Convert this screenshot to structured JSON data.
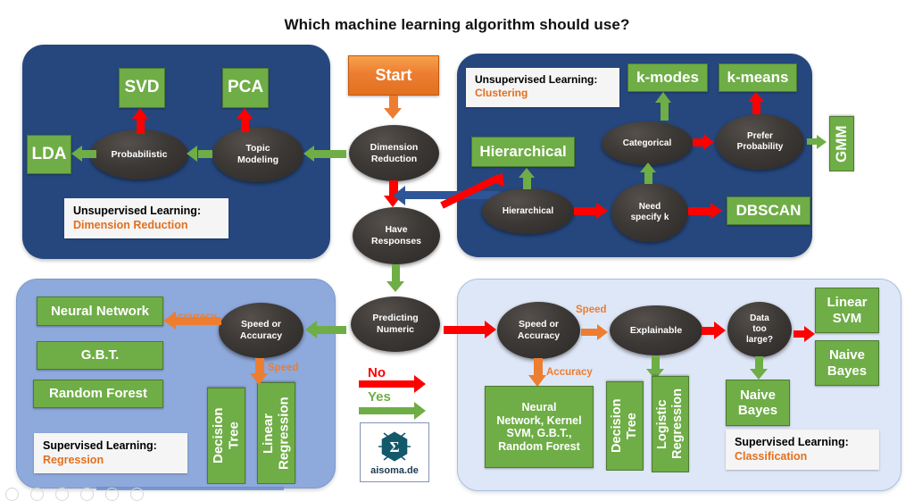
{
  "title": "Which machine learning algorithm should use?",
  "panels": {
    "dimension_reduction": {
      "caption_line1": "Unsupervised Learning:",
      "caption_line2": "Dimension Reduction",
      "color": "#26477E"
    },
    "clustering": {
      "caption_line1": "Unsupervised Learning:",
      "caption_line2": "Clustering",
      "color": "#26477E"
    },
    "regression": {
      "caption_line1": "Supervised Learning:",
      "caption_line2": "Regression",
      "color": "#8EA9DB"
    },
    "classification": {
      "caption_line1": "Supervised Learning:",
      "caption_line2": "Classification",
      "color": "#DEE7F7"
    }
  },
  "start": {
    "label": "Start"
  },
  "spine": {
    "dimension_reduction": "Dimension\nReduction",
    "have_responses": "Have\nResponses",
    "predicting_numeric": "Predicting\nNumeric"
  },
  "nodes": {
    "probabilistic": "Probabilistic",
    "topic_modeling": "Topic\nModeling",
    "hierarchical": "Hierarchical",
    "need_specify_k": "Need\nspecify k",
    "categorical": "Categorical",
    "prefer_probability": "Prefer\nProbability",
    "speed_or_accuracy_reg": "Speed or\nAccuracy",
    "speed_or_accuracy_cls": "Speed or\nAccuracy",
    "explainable": "Explainable",
    "data_too_large": "Data\ntoo\nlarge?"
  },
  "outcomes": {
    "svd": "SVD",
    "pca": "PCA",
    "lda": "LDA",
    "hierarchical_out": "Hierarchical",
    "k_modes": "k-modes",
    "k_means": "k-means",
    "gmm": "GMM",
    "dbscan": "DBSCAN",
    "neural_network": "Neural Network",
    "gbt": "G.B.T.",
    "random_forest": "Random Forest",
    "decision_tree_reg": "Decision\nTree",
    "linear_regression": "Linear\nRegression",
    "nn_kernel_svm_gbt_rf": "Neural\nNetwork, Kernel\nSVM, G.B.T.,\nRandom Forest",
    "decision_tree_cls": "Decision\nTree",
    "logistic_regression": "Logistic\nRegression",
    "naive_bayes_mid": "Naive\nBayes",
    "linear_svm": "Linear\nSVM",
    "naive_bayes_right": "Naive\nBayes"
  },
  "edge_labels": {
    "accuracy_reg": "Accuracy",
    "speed_reg": "Speed",
    "speed_cls": "Speed",
    "accuracy_cls": "Accuracy"
  },
  "legend": {
    "no": "No",
    "yes": "Yes"
  },
  "logo": {
    "text": "aisoma.de",
    "symbol": "Σ"
  },
  "colors": {
    "green": "#6FAD46",
    "orange": "#ED7D31",
    "red": "#FF0000",
    "navy": "#26477E",
    "steel_blue": "#2E5597",
    "periwinkle": "#8EA9DB",
    "pale_blue": "#DEE7F7",
    "node_dark": "#3D3936",
    "caption_accent": "#E2701F"
  }
}
